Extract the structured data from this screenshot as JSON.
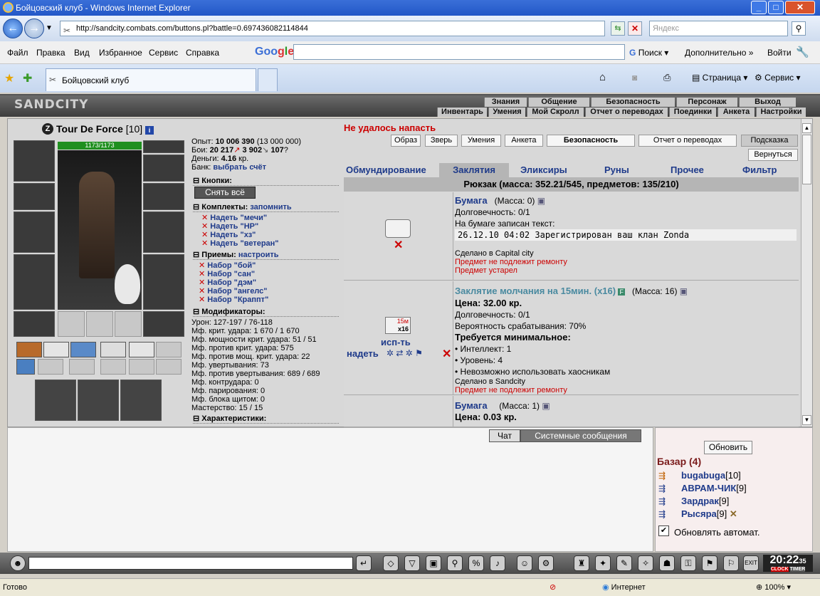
{
  "browser": {
    "window_title": "Бойцовский клуб - Windows Internet Explorer",
    "url": "http://sandcity.combats.com/buttons.pl?battle=0.697436082114844",
    "search_placeholder": "Яндекс",
    "menu": [
      "Файл",
      "Правка",
      "Вид",
      "Избранное",
      "Сервис",
      "Справка"
    ],
    "google_search_btn": "Поиск",
    "google_more": "Дополнительно »",
    "google_login": "Войти",
    "tab_title": "Бойцовский клуб",
    "cmd_page": "Страница",
    "cmd_service": "Сервис",
    "status_text": "Готово",
    "status_zone": "Интернет",
    "zoom": "100%"
  },
  "game_header": {
    "logo": "SANDCITY",
    "top_links": [
      "Знания",
      "Общение",
      "Безопасность",
      "Персонаж",
      "Выход"
    ],
    "sub_links": [
      "Инвентарь",
      "Умения",
      "Мой Скролл",
      "Отчет о переводах",
      "Поединки",
      "Анкета",
      "Настройки"
    ]
  },
  "character": {
    "name": "Tour De Force",
    "level": "[10]",
    "hp": "1173/1173"
  },
  "stats": {
    "exp_label": "Опыт:",
    "exp_value": "10 006 390",
    "exp_next": "(13 000 000)",
    "fights_label": "Бои:",
    "wins": "20 217",
    "losses": "3 902",
    "draws": "107",
    "money_label": "Деньги:",
    "money_value": "4.16",
    "money_unit": "кр.",
    "bank_label": "Банк:",
    "bank_link": "выбрать счёт",
    "buttons_head": "Кнопки:",
    "take_off_all": "Снять всё",
    "sets_head": "Комплекты:",
    "sets_remember": "запомнить",
    "sets": [
      "Надеть \"мечи\"",
      "Надеть \"НР\"",
      "Надеть \"хз\"",
      "Надеть \"ветеран\""
    ],
    "tricks_head": "Приемы:",
    "tricks_setup": "настроить",
    "tricks": [
      "Набор \"бой\"",
      "Набор \"сан\"",
      "Набор \"дэм\"",
      "Набор \"ангелс\"",
      "Набор \"Краппт\""
    ],
    "mods_head": "Модификаторы:",
    "mods": [
      "Урон: 127-197 / 76-118",
      "Мф. крит. удара: 1 670 / 1 670",
      "Мф. мощности крит. удара: 51 / 51",
      "Мф. против крит. удара: 575",
      "Мф. против мощ. крит. удара: 22",
      "Мф. увертывания: 73",
      "Мф. против увертывания: 689 / 689",
      "Мф. контрудара: 0",
      "Мф. парирования: 0",
      "Мф. блока щитом: 0",
      "Мастерство: 15 / 15"
    ],
    "chars_head": "Характеристики:"
  },
  "inventory": {
    "error": "Не удалось напасть",
    "top_buttons": [
      "Образ",
      "Зверь",
      "Умения",
      "Анкета",
      "Безопасность",
      "Отчет о переводах",
      "Подсказка"
    ],
    "back_button": "Вернуться",
    "tabs": [
      "Обмундирование",
      "Заклятия",
      "Эликсиры",
      "Руны",
      "Прочее",
      "Фильтр"
    ],
    "rucksack": "Рюкзак (масса: 352.21/545, предметов: 135/210)",
    "item1": {
      "name": "Бумага",
      "mass": "(Масса: 0)",
      "durability": "Долговечность: 0/1",
      "paper_label": "На бумаге записан текст:",
      "paper_text": "26.12.10 04:02 Зарегистрирован ваш клан Zonda",
      "made_in": "Сделано в Capital city",
      "note1": "Предмет не подлежит ремонту",
      "note2": "Предмет устарел"
    },
    "item2": {
      "name": "Заклятие молчания на 15мин. (x16)",
      "mass": "(Масса: 16)",
      "icon_label": "15м",
      "icon_count": "x16",
      "use_link": "исп-ть",
      "wear_link": "надеть",
      "price": "Цена: 32.00 кр.",
      "durability": "Долговечность: 0/1",
      "chance": "Вероятность срабатывания: 70%",
      "req_head": "Требуется минимальное:",
      "req1": "• Интеллект: 1",
      "req2": "• Уровень: 4",
      "req3": "• Невозможно использовать хаосникам",
      "made_in": "Сделано в Sandcity",
      "note1": "Предмет не подлежит ремонту"
    },
    "item3": {
      "name": "Бумага",
      "mass": "(Масса: 1)",
      "price": "Цена: 0.03 кр."
    }
  },
  "chat": {
    "tab_chat": "Чат",
    "tab_system": "Системные сообщения"
  },
  "bazaar": {
    "refresh": "Обновить",
    "title": "Базар (4)",
    "users": [
      {
        "name": "bugabuga",
        "level": "[10]"
      },
      {
        "name": "АВРАМ-ЧИК",
        "level": "[9]"
      },
      {
        "name": "Зардрак",
        "level": "[9]"
      },
      {
        "name": "Рысяра",
        "level": "[9]"
      }
    ],
    "auto_refresh": "Обновлять автомат."
  },
  "toolbar": {
    "clock": "20:22",
    "clock_sub": "35",
    "clock_label1": "CLOCK",
    "clock_label2": "TIMER",
    "exit_label": "EXIT"
  }
}
